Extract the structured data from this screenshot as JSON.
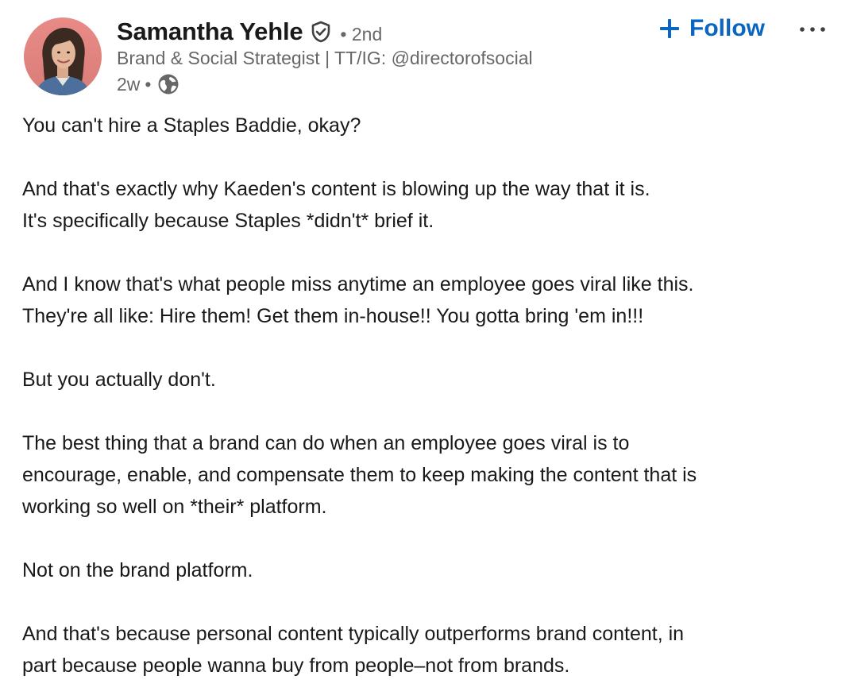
{
  "author": {
    "name": "Samantha Yehle",
    "degree": "• 2nd",
    "headline": "Brand & Social Strategist | TT/IG: @directorofsocial",
    "time": "2w",
    "meta_separator": "•",
    "verified_icon": "verified-shield-icon",
    "visibility_icon": "globe-icon"
  },
  "actions": {
    "follow_label": "Follow",
    "follow_icon": "plus-icon",
    "more_label": "···",
    "accent_color": "#0a66c2"
  },
  "post": {
    "lines": [
      "You can't hire a Staples Baddie, okay?",
      "",
      "And that's exactly why Kaeden's content is blowing up the way that it is.",
      "It's specifically because Staples *didn't* brief it.",
      "",
      "And I know that's what people miss anytime an employee goes viral like this.",
      "They're all like: Hire them! Get them in-house!! You gotta bring 'em in!!!",
      "",
      "But you actually don't.",
      "",
      "The best thing that a brand can do when an employee goes viral is to",
      "encourage, enable, and compensate them to keep making the content that is",
      "working so well on *their* platform.",
      "",
      "Not on the brand platform.",
      "",
      "And that's because personal content typically outperforms brand content, in",
      "part because people wanna buy from people–not from brands."
    ]
  }
}
